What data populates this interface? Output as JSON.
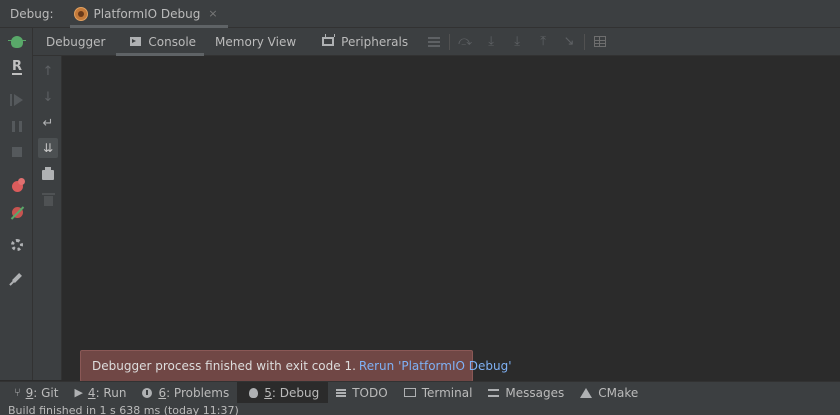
{
  "title_bar": {
    "label": "Debug:",
    "session_tab": {
      "title": "PlatformIO Debug",
      "close": "×"
    }
  },
  "tabs": [
    {
      "label": "Debugger"
    },
    {
      "label": "Console"
    },
    {
      "label": "Memory View"
    },
    {
      "label": "Peripherals"
    }
  ],
  "console": {
    "arrow_up": "↑",
    "arrow_down": "↓",
    "soft_wrap": "↵",
    "scroll_to_end": "⇊"
  },
  "notification": {
    "message": "Debugger process finished with exit code 1.",
    "link": "Rerun 'PlatformIO Debug'"
  },
  "bottom_bar": {
    "git": {
      "num": "9",
      "label": ": Git"
    },
    "run": {
      "num": "4",
      "label": ": Run"
    },
    "problems": {
      "num": "6",
      "label": ": Problems"
    },
    "debug": {
      "num": "5",
      "label": ": Debug"
    },
    "todo": {
      "label": "TODO"
    },
    "terminal": {
      "label": "Terminal"
    },
    "messages": {
      "label": "Messages"
    },
    "cmake": {
      "label": "CMake"
    }
  },
  "status": {
    "text": "Build finished in 1 s 638 ms (today 11:37)"
  },
  "colors": {
    "panel": "#3c3f41",
    "editor": "#2b2b2b",
    "notification_bg": "#704745",
    "link": "#7fb1f5",
    "accent_green": "#59a869",
    "breakpoint_red": "#db5c5c"
  }
}
